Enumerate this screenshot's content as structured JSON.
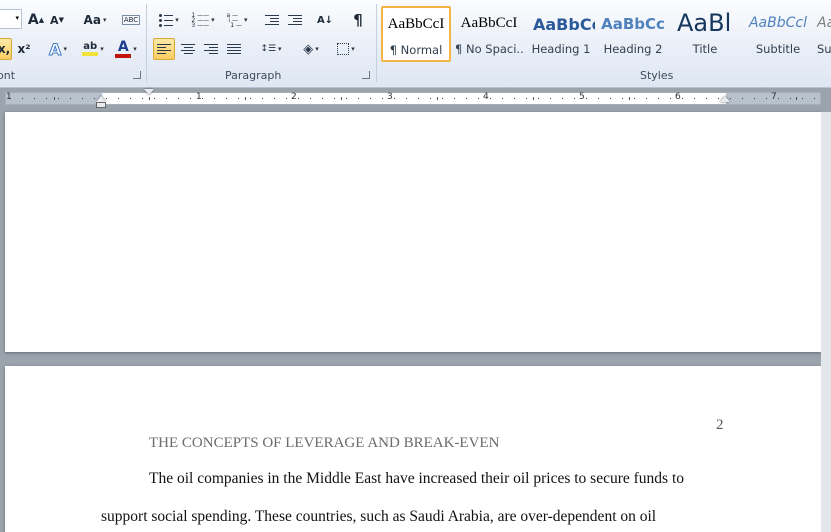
{
  "ribbon": {
    "font_group_label": "ont",
    "paragraph_group_label": "Paragraph",
    "styles_group_label": "Styles",
    "change_case_label": "Aa",
    "grow_font_label": "A",
    "shrink_font_label": "A",
    "subscript_label": "x,",
    "superscript_label": "x²",
    "text_effects_label": "A",
    "highlight_label": "ab",
    "font_color_label": "A",
    "sort_label": "A↓",
    "pilcrow_label": "¶",
    "clear_format_label": "ABC"
  },
  "styles": [
    {
      "sample": "AaBbCcI",
      "name": "¶ Normal",
      "selected": true
    },
    {
      "sample": "AaBbCcI",
      "name": "¶ No Spaci..."
    },
    {
      "sample": "AaBbCc",
      "name": "Heading 1"
    },
    {
      "sample": "AaBbCc",
      "name": "Heading 2"
    },
    {
      "sample": "AaBl",
      "name": "Title"
    },
    {
      "sample": "AaBbCcl",
      "name": "Subtitle"
    },
    {
      "sample": "Aa",
      "name": "Su"
    }
  ],
  "ruler": {
    "numbers": [
      "1",
      "1",
      "2",
      "3",
      "4",
      "5",
      "6",
      "7"
    ]
  },
  "document": {
    "page_number": "2",
    "running_head": "THE CONCEPTS OF LEVERAGE AND BREAK-EVEN",
    "line1": "The oil companies in the Middle East have increased their oil prices to secure funds to",
    "line2": "support social spending. These countries, such as Saudi Arabia, are over-dependent on oil"
  },
  "colors": {
    "highlight": "#f3e23a",
    "font_color": "#c0140c",
    "heading1": "#2a5a9a",
    "heading2": "#4f81bd",
    "selected_border": "#f4b548"
  }
}
